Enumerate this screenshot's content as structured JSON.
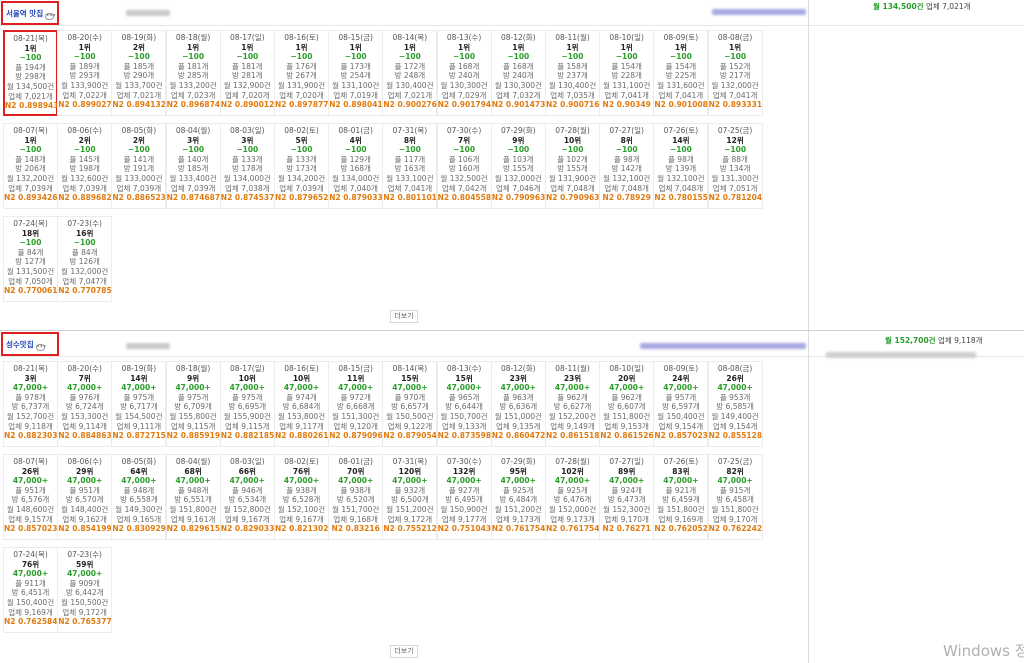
{
  "more_label": "더보기",
  "watermark": "Windows 정",
  "sections": [
    {
      "keyword": "서울역 맛집",
      "summary_total": "월 134,500건",
      "summary_biz": "업체 7,021개",
      "cards": [
        {
          "date": "08-21(목)",
          "rank": "1위",
          "change": "−100",
          "m1": "플 194개",
          "m2": "방 298개",
          "m3": "월 134,500건",
          "m4": "업체 7,021개",
          "n2": "N2 0.898943"
        },
        {
          "date": "08-20(수)",
          "rank": "1위",
          "change": "−100",
          "m1": "플 189개",
          "m2": "방 293개",
          "m3": "월 133,900건",
          "m4": "업체 7,022개",
          "n2": "N2 0.899027"
        },
        {
          "date": "08-19(화)",
          "rank": "2위",
          "change": "−100",
          "m1": "플 185개",
          "m2": "방 290개",
          "m3": "월 133,700건",
          "m4": "업체 7,021개",
          "n2": "N2 0.894132"
        },
        {
          "date": "08-18(월)",
          "rank": "1위",
          "change": "−100",
          "m1": "플 181개",
          "m2": "방 285개",
          "m3": "월 133,200건",
          "m4": "업체 7,023개",
          "n2": "N2 0.896874"
        },
        {
          "date": "08-17(일)",
          "rank": "1위",
          "change": "−100",
          "m1": "플 181개",
          "m2": "방 281개",
          "m3": "월 132,900건",
          "m4": "업체 7,020개",
          "n2": "N2 0.890012"
        },
        {
          "date": "08-16(토)",
          "rank": "1위",
          "change": "−100",
          "m1": "플 176개",
          "m2": "방 267개",
          "m3": "월 131,900건",
          "m4": "업체 7,020개",
          "n2": "N2 0.897877"
        },
        {
          "date": "08-15(금)",
          "rank": "1위",
          "change": "−100",
          "m1": "플 173개",
          "m2": "방 254개",
          "m3": "월 131,100건",
          "m4": "업체 7,019개",
          "n2": "N2 0.898041"
        },
        {
          "date": "08-14(목)",
          "rank": "1위",
          "change": "−100",
          "m1": "플 172개",
          "m2": "방 248개",
          "m3": "월 130,400건",
          "m4": "업체 7,021개",
          "n2": "N2 0.900276"
        },
        {
          "date": "08-13(수)",
          "rank": "1위",
          "change": "−100",
          "m1": "플 168개",
          "m2": "방 240개",
          "m3": "월 130,300건",
          "m4": "업체 7,029개",
          "n2": "N2 0.901794"
        },
        {
          "date": "08-12(화)",
          "rank": "1위",
          "change": "−100",
          "m1": "플 168개",
          "m2": "방 240개",
          "m3": "월 130,300건",
          "m4": "업체 7,032개",
          "n2": "N2 0.901473"
        },
        {
          "date": "08-11(월)",
          "rank": "1위",
          "change": "−100",
          "m1": "플 158개",
          "m2": "방 237개",
          "m3": "월 130,400건",
          "m4": "업체 7,035개",
          "n2": "N2 0.900716"
        },
        {
          "date": "08-10(일)",
          "rank": "1위",
          "change": "−100",
          "m1": "플 154개",
          "m2": "방 228개",
          "m3": "월 131,100건",
          "m4": "업체 7,041개",
          "n2": "N2 0.90349"
        },
        {
          "date": "08-09(토)",
          "rank": "1위",
          "change": "−100",
          "m1": "플 154개",
          "m2": "방 225개",
          "m3": "월 131,600건",
          "m4": "업체 7,041개",
          "n2": "N2 0.901008"
        },
        {
          "date": "08-08(금)",
          "rank": "1위",
          "change": "−100",
          "m1": "플 152개",
          "m2": "방 217개",
          "m3": "월 132,000건",
          "m4": "업체 7,041개",
          "n2": "N2 0.893331"
        },
        {
          "date": "08-07(목)",
          "rank": "1위",
          "change": "−100",
          "m1": "플 148개",
          "m2": "방 206개",
          "m3": "월 132,200건",
          "m4": "업체 7,039개",
          "n2": "N2 0.893426"
        },
        {
          "date": "08-06(수)",
          "rank": "2위",
          "change": "−100",
          "m1": "플 145개",
          "m2": "방 198개",
          "m3": "월 132,600건",
          "m4": "업체 7,039개",
          "n2": "N2 0.889682"
        },
        {
          "date": "08-05(화)",
          "rank": "2위",
          "change": "−100",
          "m1": "플 141개",
          "m2": "방 191개",
          "m3": "월 133,000건",
          "m4": "업체 7,039개",
          "n2": "N2 0.886523"
        },
        {
          "date": "08-04(월)",
          "rank": "3위",
          "change": "−100",
          "m1": "플 140개",
          "m2": "방 185개",
          "m3": "월 133,400건",
          "m4": "업체 7,039개",
          "n2": "N2 0.874687"
        },
        {
          "date": "08-03(일)",
          "rank": "3위",
          "change": "−100",
          "m1": "플 133개",
          "m2": "방 178개",
          "m3": "월 134,000건",
          "m4": "업체 7,038개",
          "n2": "N2 0.874537"
        },
        {
          "date": "08-02(토)",
          "rank": "5위",
          "change": "−100",
          "m1": "플 133개",
          "m2": "방 173개",
          "m3": "월 134,200건",
          "m4": "업체 7,039개",
          "n2": "N2 0.879652"
        },
        {
          "date": "08-01(금)",
          "rank": "4위",
          "change": "−100",
          "m1": "플 129개",
          "m2": "방 168개",
          "m3": "월 134,000건",
          "m4": "업체 7,040개",
          "n2": "N2 0.879033"
        },
        {
          "date": "07-31(목)",
          "rank": "8위",
          "change": "−100",
          "m1": "플 117개",
          "m2": "방 163개",
          "m3": "월 133,100건",
          "m4": "업체 7,041개",
          "n2": "N2 0.801101"
        },
        {
          "date": "07-30(수)",
          "rank": "7위",
          "change": "−100",
          "m1": "플 106개",
          "m2": "방 160개",
          "m3": "월 132,500건",
          "m4": "업체 7,042개",
          "n2": "N2 0.804558"
        },
        {
          "date": "07-29(화)",
          "rank": "9위",
          "change": "−100",
          "m1": "플 103개",
          "m2": "방 155개",
          "m3": "월 132,000건",
          "m4": "업체 7,046개",
          "n2": "N2 0.790963"
        },
        {
          "date": "07-28(월)",
          "rank": "10위",
          "change": "−100",
          "m1": "플 102개",
          "m2": "방 155개",
          "m3": "월 131,900건",
          "m4": "업체 7,048개",
          "n2": "N2 0.790963"
        },
        {
          "date": "07-27(일)",
          "rank": "8위",
          "change": "−100",
          "m1": "플 98개",
          "m2": "방 142개",
          "m3": "월 132,100건",
          "m4": "업체 7,048개",
          "n2": "N2 0.78929"
        },
        {
          "date": "07-26(토)",
          "rank": "14위",
          "change": "−100",
          "m1": "플 98개",
          "m2": "방 139개",
          "m3": "월 132,100건",
          "m4": "업체 7,048개",
          "n2": "N2 0.780155"
        },
        {
          "date": "07-25(금)",
          "rank": "12위",
          "change": "−100",
          "m1": "플 88개",
          "m2": "방 134개",
          "m3": "월 131,300건",
          "m4": "업체 7,051개",
          "n2": "N2 0.781204"
        },
        {
          "date": "07-24(목)",
          "rank": "18위",
          "change": "−100",
          "m1": "플 84개",
          "m2": "방 127개",
          "m3": "월 131,500건",
          "m4": "업체 7,050개",
          "n2": "N2 0.770061"
        },
        {
          "date": "07-23(수)",
          "rank": "16위",
          "change": "−100",
          "m1": "플 84개",
          "m2": "방 126개",
          "m3": "월 132,000건",
          "m4": "업체 7,047개",
          "n2": "N2 0.770785"
        }
      ]
    },
    {
      "keyword": "성수맛집",
      "summary_total": "월 152,700건",
      "summary_biz": "업체 9,118개",
      "cards": [
        {
          "date": "08-21(목)",
          "rank": "3위",
          "change": "47,000+",
          "m1": "플 978개",
          "m2": "방 6,737개",
          "m3": "월 152,700건",
          "m4": "업체 9,118개",
          "n2": "N2 0.882303"
        },
        {
          "date": "08-20(수)",
          "rank": "7위",
          "change": "47,000+",
          "m1": "플 976개",
          "m2": "방 6,724개",
          "m3": "월 153,300건",
          "m4": "업체 9,114개",
          "n2": "N2 0.884863"
        },
        {
          "date": "08-19(화)",
          "rank": "14위",
          "change": "47,000+",
          "m1": "플 975개",
          "m2": "방 6,717개",
          "m3": "월 154,500건",
          "m4": "업체 9,111개",
          "n2": "N2 0.872715"
        },
        {
          "date": "08-18(월)",
          "rank": "9위",
          "change": "47,000+",
          "m1": "플 975개",
          "m2": "방 6,709개",
          "m3": "월 155,800건",
          "m4": "업체 9,115개",
          "n2": "N2 0.885919"
        },
        {
          "date": "08-17(일)",
          "rank": "10위",
          "change": "47,000+",
          "m1": "플 975개",
          "m2": "방 6,695개",
          "m3": "월 155,900건",
          "m4": "업체 9,115개",
          "n2": "N2 0.882185"
        },
        {
          "date": "08-16(토)",
          "rank": "10위",
          "change": "47,000+",
          "m1": "플 974개",
          "m2": "방 6,684개",
          "m3": "월 153,800건",
          "m4": "업체 9,117개",
          "n2": "N2 0.880261"
        },
        {
          "date": "08-15(금)",
          "rank": "11위",
          "change": "47,000+",
          "m1": "플 972개",
          "m2": "방 6,668개",
          "m3": "월 151,300건",
          "m4": "업체 9,120개",
          "n2": "N2 0.879096"
        },
        {
          "date": "08-14(목)",
          "rank": "15위",
          "change": "47,000+",
          "m1": "플 970개",
          "m2": "방 6,657개",
          "m3": "월 150,500건",
          "m4": "업체 9,122개",
          "n2": "N2 0.879054"
        },
        {
          "date": "08-13(수)",
          "rank": "15위",
          "change": "47,000+",
          "m1": "플 965개",
          "m2": "방 6,644개",
          "m3": "월 150,700건",
          "m4": "업체 9,133개",
          "n2": "N2 0.873598"
        },
        {
          "date": "08-12(화)",
          "rank": "23위",
          "change": "47,000+",
          "m1": "플 963개",
          "m2": "방 6,636개",
          "m3": "월 151,000건",
          "m4": "업체 9,135개",
          "n2": "N2 0.860472"
        },
        {
          "date": "08-11(월)",
          "rank": "23위",
          "change": "47,000+",
          "m1": "플 962개",
          "m2": "방 6,627개",
          "m3": "월 152,200건",
          "m4": "업체 9,149개",
          "n2": "N2 0.861518"
        },
        {
          "date": "08-10(일)",
          "rank": "20위",
          "change": "47,000+",
          "m1": "플 962개",
          "m2": "방 6,607개",
          "m3": "월 151,800건",
          "m4": "업체 9,153개",
          "n2": "N2 0.861526"
        },
        {
          "date": "08-09(토)",
          "rank": "24위",
          "change": "47,000+",
          "m1": "플 957개",
          "m2": "방 6,597개",
          "m3": "월 150,400건",
          "m4": "업체 9,154개",
          "n2": "N2 0.857023"
        },
        {
          "date": "08-08(금)",
          "rank": "26위",
          "change": "47,000+",
          "m1": "플 953개",
          "m2": "방 6,585개",
          "m3": "월 149,400건",
          "m4": "업체 9,154개",
          "n2": "N2 0.855128"
        },
        {
          "date": "08-07(목)",
          "rank": "26위",
          "change": "47,000+",
          "m1": "플 951개",
          "m2": "방 6,576개",
          "m3": "월 148,600건",
          "m4": "업체 9,157개",
          "n2": "N2 0.857023"
        },
        {
          "date": "08-06(수)",
          "rank": "29위",
          "change": "47,000+",
          "m1": "플 951개",
          "m2": "방 6,570개",
          "m3": "월 148,400건",
          "m4": "업체 9,162개",
          "n2": "N2 0.854199"
        },
        {
          "date": "08-05(화)",
          "rank": "64위",
          "change": "47,000+",
          "m1": "플 948개",
          "m2": "방 6,558개",
          "m3": "월 149,300건",
          "m4": "업체 9,165개",
          "n2": "N2 0.830929"
        },
        {
          "date": "08-04(월)",
          "rank": "68위",
          "change": "47,000+",
          "m1": "플 948개",
          "m2": "방 6,551개",
          "m3": "월 151,800건",
          "m4": "업체 9,161개",
          "n2": "N2 0.829615"
        },
        {
          "date": "08-03(일)",
          "rank": "66위",
          "change": "47,000+",
          "m1": "플 946개",
          "m2": "방 6,534개",
          "m3": "월 152,800건",
          "m4": "업체 9,167개",
          "n2": "N2 0.829033"
        },
        {
          "date": "08-02(토)",
          "rank": "76위",
          "change": "47,000+",
          "m1": "플 938개",
          "m2": "방 6,528개",
          "m3": "월 152,100건",
          "m4": "업체 9,167개",
          "n2": "N2 0.821302"
        },
        {
          "date": "08-01(금)",
          "rank": "70위",
          "change": "47,000+",
          "m1": "플 938개",
          "m2": "방 6,520개",
          "m3": "월 151,700건",
          "m4": "업체 9,168개",
          "n2": "N2 0.83216"
        },
        {
          "date": "07-31(목)",
          "rank": "120위",
          "change": "47,000+",
          "m1": "플 932개",
          "m2": "방 6,500개",
          "m3": "월 151,200건",
          "m4": "업체 9,172개",
          "n2": "N2 0.755212"
        },
        {
          "date": "07-30(수)",
          "rank": "132위",
          "change": "47,000+",
          "m1": "플 927개",
          "m2": "방 6,495개",
          "m3": "월 150,900건",
          "m4": "업체 9,177개",
          "n2": "N2 0.751043"
        },
        {
          "date": "07-29(화)",
          "rank": "95위",
          "change": "47,000+",
          "m1": "플 925개",
          "m2": "방 6,484개",
          "m3": "월 151,200건",
          "m4": "업체 9,173개",
          "n2": "N2 0.761754"
        },
        {
          "date": "07-28(월)",
          "rank": "102위",
          "change": "47,000+",
          "m1": "플 925개",
          "m2": "방 6,476개",
          "m3": "월 152,000건",
          "m4": "업체 9,173개",
          "n2": "N2 0.761754"
        },
        {
          "date": "07-27(일)",
          "rank": "89위",
          "change": "47,000+",
          "m1": "플 924개",
          "m2": "방 6,473개",
          "m3": "월 152,300건",
          "m4": "업체 9,170개",
          "n2": "N2 0.76271"
        },
        {
          "date": "07-26(토)",
          "rank": "83위",
          "change": "47,000+",
          "m1": "플 921개",
          "m2": "방 6,459개",
          "m3": "월 151,800건",
          "m4": "업체 9,169개",
          "n2": "N2 0.762052"
        },
        {
          "date": "07-25(금)",
          "rank": "82위",
          "change": "47,000+",
          "m1": "플 915개",
          "m2": "방 6,458개",
          "m3": "월 151,800건",
          "m4": "업체 9,170개",
          "n2": "N2 0.762242"
        },
        {
          "date": "07-24(목)",
          "rank": "76위",
          "change": "47,000+",
          "m1": "플 911개",
          "m2": "방 6,451개",
          "m3": "월 150,400건",
          "m4": "업체 9,169개",
          "n2": "N2 0.762584"
        },
        {
          "date": "07-23(수)",
          "rank": "59위",
          "change": "47,000+",
          "m1": "플 909개",
          "m2": "방 6,442개",
          "m3": "월 150,500건",
          "m4": "업체 9,172개",
          "n2": "N2 0.765377"
        }
      ]
    }
  ]
}
